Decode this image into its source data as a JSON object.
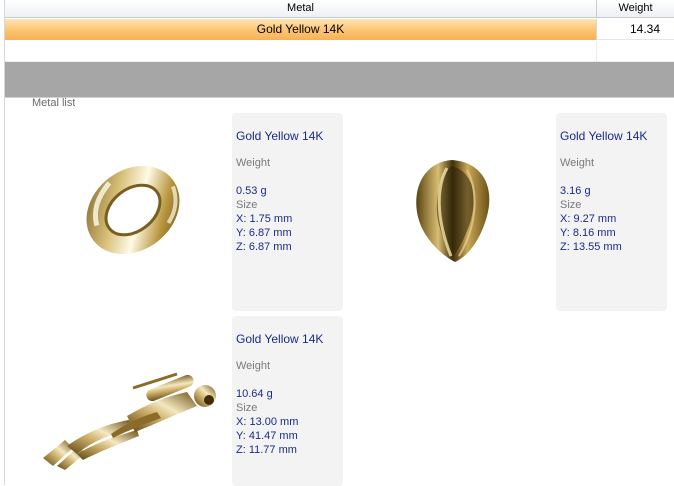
{
  "grid": {
    "columns": {
      "metal": "Metal",
      "weight": "Weight"
    },
    "rows": [
      {
        "metal": "Gold Yellow 14K",
        "weight": "14.34"
      }
    ]
  },
  "panel": {
    "title": "Metal list"
  },
  "items": [
    {
      "metal": "Gold Yellow 14K",
      "weight_label": "Weight",
      "weight": "0.53 g",
      "size_label": "Size",
      "x": "X: 1.75 mm",
      "y": "Y: 6.87 mm",
      "z": "Z: 6.87 mm"
    },
    {
      "metal": "Gold Yellow 14K",
      "weight_label": "Weight",
      "weight": "3.16 g",
      "size_label": "Size",
      "x": "X: 9.27 mm",
      "y": "Y: 8.16 mm",
      "z": "Z: 13.55 mm"
    },
    {
      "metal": "Gold Yellow 14K",
      "weight_label": "Weight",
      "weight": "10.64 g",
      "size_label": "Size",
      "x": "X: 13.00 mm",
      "y": "Y: 41.47 mm",
      "z": "Z: 11.77 mm"
    }
  ],
  "colors": {
    "selected_row": "#fbc470",
    "info_text": "#1a2a8a",
    "band": "#a6a6a6",
    "card_bg": "#f3f3f3"
  }
}
